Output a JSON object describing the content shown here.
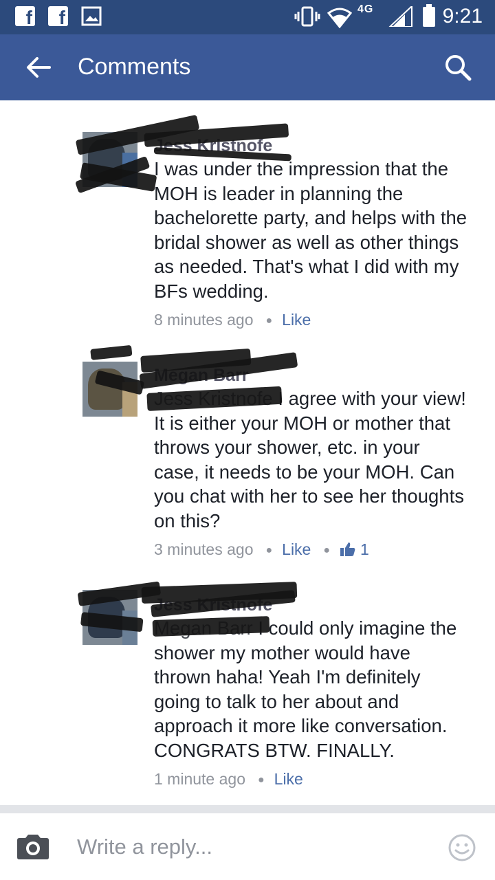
{
  "status_bar": {
    "time": "9:21",
    "network": "4G",
    "icons": [
      "facebook-icon",
      "facebook-icon",
      "image-icon",
      "vibrate-icon",
      "wifi-icon",
      "signal-icon",
      "battery-icon"
    ]
  },
  "header": {
    "title": "Comments",
    "back_icon": "back-arrow-icon",
    "search_icon": "search-icon"
  },
  "comments": [
    {
      "author": "Jess Kristnofe",
      "text": "I was under the impression that the MOH is leader in planning the bachelorette party, and helps with the bridal shower as well as other things as needed. That's what I did with my BFs wedding.",
      "time": "8 minutes ago",
      "like_label": "Like"
    },
    {
      "author": "Megan Barr",
      "mention": "Jess Kristnofe",
      "text": "I agree with your view! It is either your MOH or mother that throws your shower, etc. in your case, it needs to be your MOH. Can you chat with her to see her thoughts on this?",
      "time": "3 minutes ago",
      "like_label": "Like",
      "like_count": "1"
    },
    {
      "author": "Jess Kristnofe",
      "mention": "Megan Barr",
      "text": "I could only imagine the shower my mother would have thrown haha! Yeah I'm definitely going to talk to her about and approach it more like conversation. CONGRATS BTW. FINALLY.",
      "time": "1 minute ago",
      "like_label": "Like"
    }
  ],
  "composer": {
    "placeholder": "Write a reply...",
    "camera_icon": "camera-icon",
    "emoji_icon": "smiley-icon"
  },
  "colors": {
    "status_bar": "#2c4a7c",
    "header": "#3b5998",
    "link": "#4b6ea9",
    "meta": "#90949c"
  }
}
